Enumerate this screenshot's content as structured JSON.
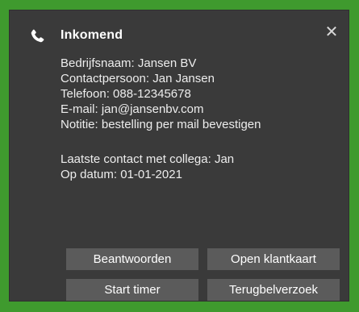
{
  "notification": {
    "title": "Inkomend",
    "close_glyph": "✕",
    "details": {
      "company": "Bedrijfsnaam: Jansen BV",
      "contact": "Contactpersoon: Jan Jansen",
      "phone": "Telefoon: 088-12345678",
      "email": "E-mail: jan@jansenbv.com",
      "note": "Notitie: bestelling per mail bevestigen",
      "last_contact": "Laatste contact met collega: Jan",
      "date": "Op datum: 01-01-2021"
    },
    "buttons": {
      "answer": "Beantwoorden",
      "open_card": "Open klantkaart",
      "start_timer": "Start timer",
      "callback": "Terugbelverzoek"
    }
  },
  "colors": {
    "border": "#3f9a2e",
    "background": "#3a3a3a",
    "button": "#5b5b5b",
    "text": "#ffffff"
  },
  "icons": {
    "phone": "phone-icon",
    "close": "close-icon"
  }
}
